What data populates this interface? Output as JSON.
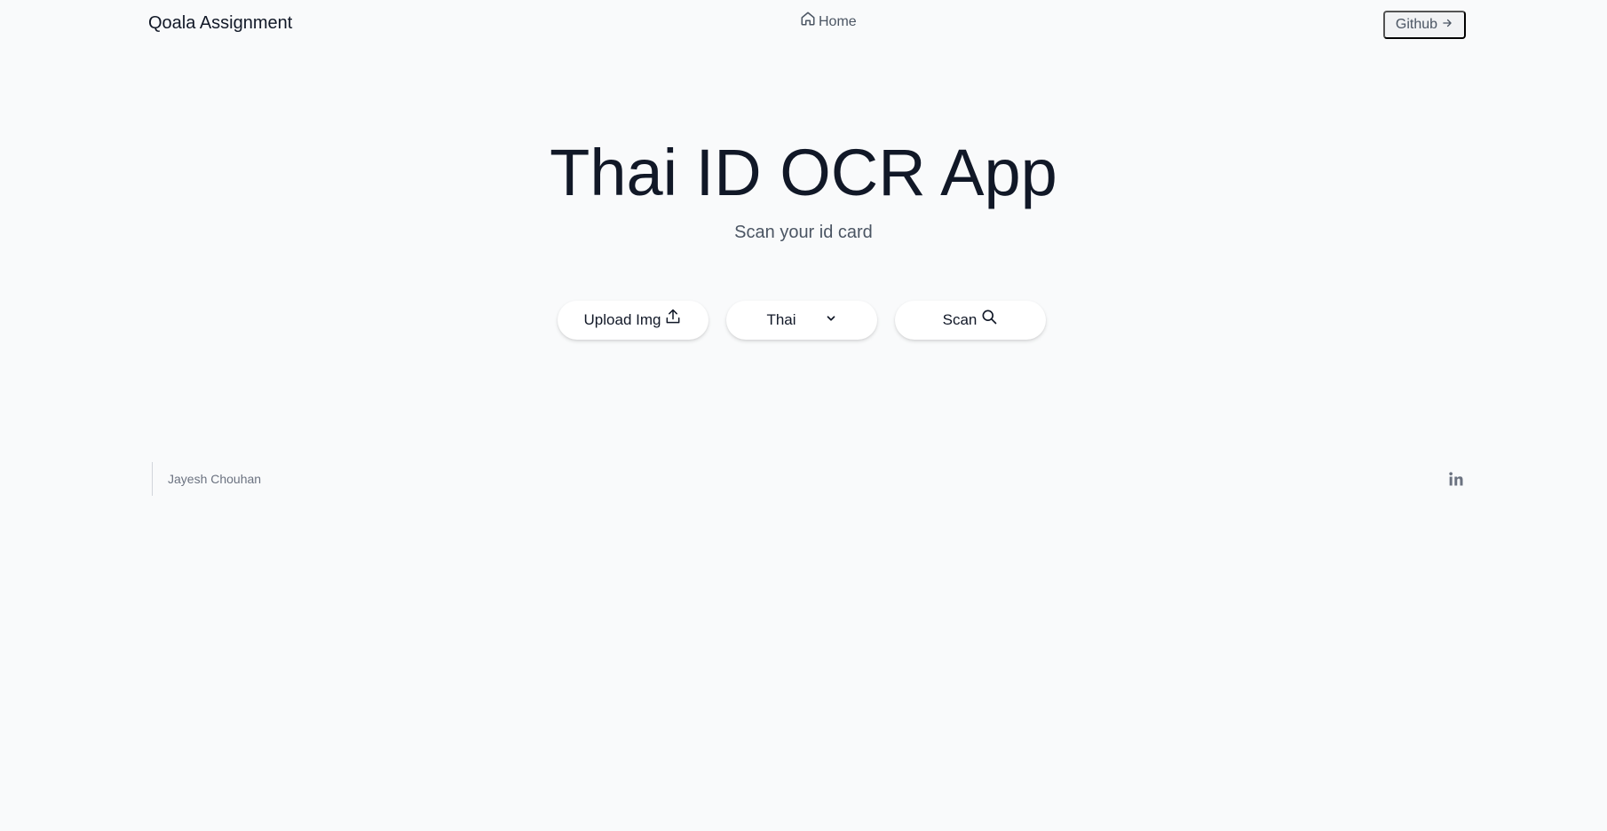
{
  "header": {
    "brand": "Qoala Assignment",
    "nav_home": "Home",
    "github_label": "Github"
  },
  "hero": {
    "title": "Thai ID OCR App",
    "subtitle": "Scan your id card"
  },
  "actions": {
    "upload_label": "Upload Img",
    "language_selected": "Thai",
    "scan_label": "Scan"
  },
  "footer": {
    "author": "Jayesh Chouhan"
  },
  "icons": {
    "home": "home-icon",
    "arrow": "arrow-right-icon",
    "upload": "upload-icon",
    "chevron": "chevron-down-icon",
    "search": "search-icon",
    "linkedin": "linkedin-icon"
  },
  "colors": {
    "background": "#f9fafb",
    "text_primary": "#111827",
    "text_secondary": "#4b5563",
    "muted": "#6b7280"
  }
}
